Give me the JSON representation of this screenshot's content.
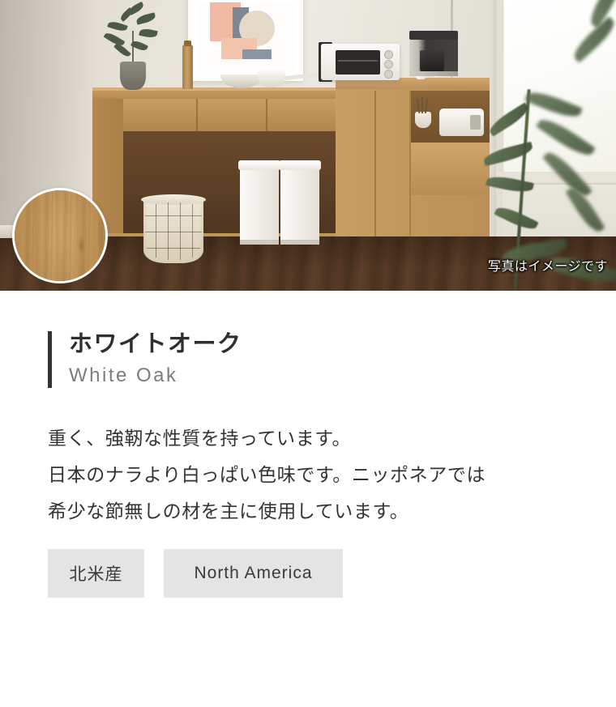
{
  "hero": {
    "caption": "写真はイメージです",
    "alt_description": "木製サイドボードとキッチン家電のある室内",
    "swatch": {
      "name": "white-oak-swatch",
      "colors": {
        "light": "#d5ac73",
        "mid": "#c99c61",
        "dark": "#bd8f55",
        "border": "#ffffff"
      }
    },
    "scene_items": [
      "potted-plant",
      "framed-art",
      "pepper-mill",
      "bowls",
      "toaster-oven",
      "glass-bottles",
      "coffee-maker",
      "rice-cooker",
      "utensil-cup",
      "wire-basket",
      "trash-bins",
      "window",
      "olive-plant"
    ]
  },
  "material": {
    "title_ja": "ホワイトオーク",
    "title_en": "White Oak",
    "description_lines": [
      "重く、強靭な性質を持っています。",
      "日本のナラより白っぱい色味です。ニッポネアでは",
      "希少な節無しの材を主に使用しています。"
    ],
    "tags": [
      {
        "label": "北米産",
        "lang": "ja"
      },
      {
        "label": "North America",
        "lang": "en"
      }
    ]
  },
  "theme": {
    "accent_bar": "#333333",
    "title_color": "#2e2e2e",
    "subtitle_color": "#7c7c7c",
    "body_color": "#333333",
    "tag_background": "#e4e4e4",
    "page_background": "#ffffff"
  }
}
